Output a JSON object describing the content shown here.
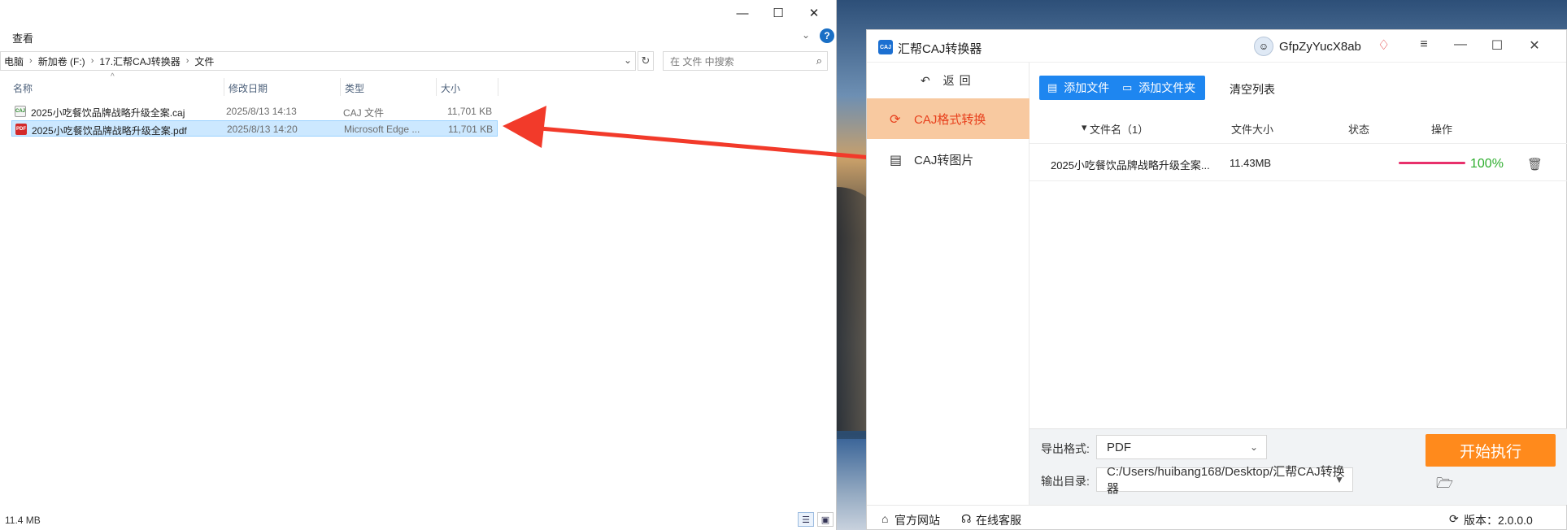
{
  "explorer": {
    "ribbon_view_tab": "查看",
    "address": [
      "电脑",
      "新加卷 (F:)",
      "17.汇帮CAJ转换器",
      "文件"
    ],
    "search_placeholder": "在 文件 中搜索",
    "columns": {
      "name": "名称",
      "date": "修改日期",
      "type": "类型",
      "size": "大小"
    },
    "files": [
      {
        "name": "2025小吃餐饮品牌战略升级全案.caj",
        "date": "2025/8/13 14:13",
        "type": "CAJ 文件",
        "size": "11,701 KB",
        "icon": "caj-file-icon",
        "selected": false
      },
      {
        "name": "2025小吃餐饮品牌战略升级全案.pdf",
        "date": "2025/8/13 14:20",
        "type": "Microsoft Edge ...",
        "size": "11,701 KB",
        "icon": "pdf-file-icon",
        "selected": true
      }
    ],
    "status": "11.4 MB",
    "window_controls": {
      "minimize": "—",
      "maximize": "☐",
      "close": "✕"
    }
  },
  "app": {
    "title": "汇帮CAJ转换器",
    "logo_text": "CAJ",
    "username": "GfpZyYucX8ab",
    "back_label": "返回",
    "sidebar": [
      {
        "label": "CAJ格式转换",
        "icon": "refresh-icon",
        "active": true
      },
      {
        "label": "CAJ转图片",
        "icon": "image-doc-icon",
        "active": false
      }
    ],
    "toolbar": {
      "add_file": "添加文件",
      "add_folder": "添加文件夹",
      "clear_list": "清空列表"
    },
    "table": {
      "headers": {
        "name": "文件名（1）",
        "size": "文件大小",
        "status": "状态",
        "action": "操作"
      },
      "rows": [
        {
          "name": "2025小吃餐饮品牌战略升级全案...",
          "size": "11.43MB",
          "progress": 100,
          "progress_label": "100%"
        }
      ]
    },
    "export_format_label": "导出格式:",
    "export_format_value": "PDF",
    "output_dir_label": "输出目录:",
    "output_dir_value": "C:/Users/huibang168/Desktop/汇帮CAJ转换器",
    "start_button": "开始执行",
    "footer": {
      "website": "官方网站",
      "support": "在线客服",
      "version": "版本：2.0.0.0"
    },
    "colors": {
      "accent": "#1e86f0",
      "active_bg": "#f8c9a0",
      "active_text": "#e8401d",
      "start": "#ff8a1c",
      "progress": "#e8306b",
      "percent": "#2eae2e"
    }
  }
}
